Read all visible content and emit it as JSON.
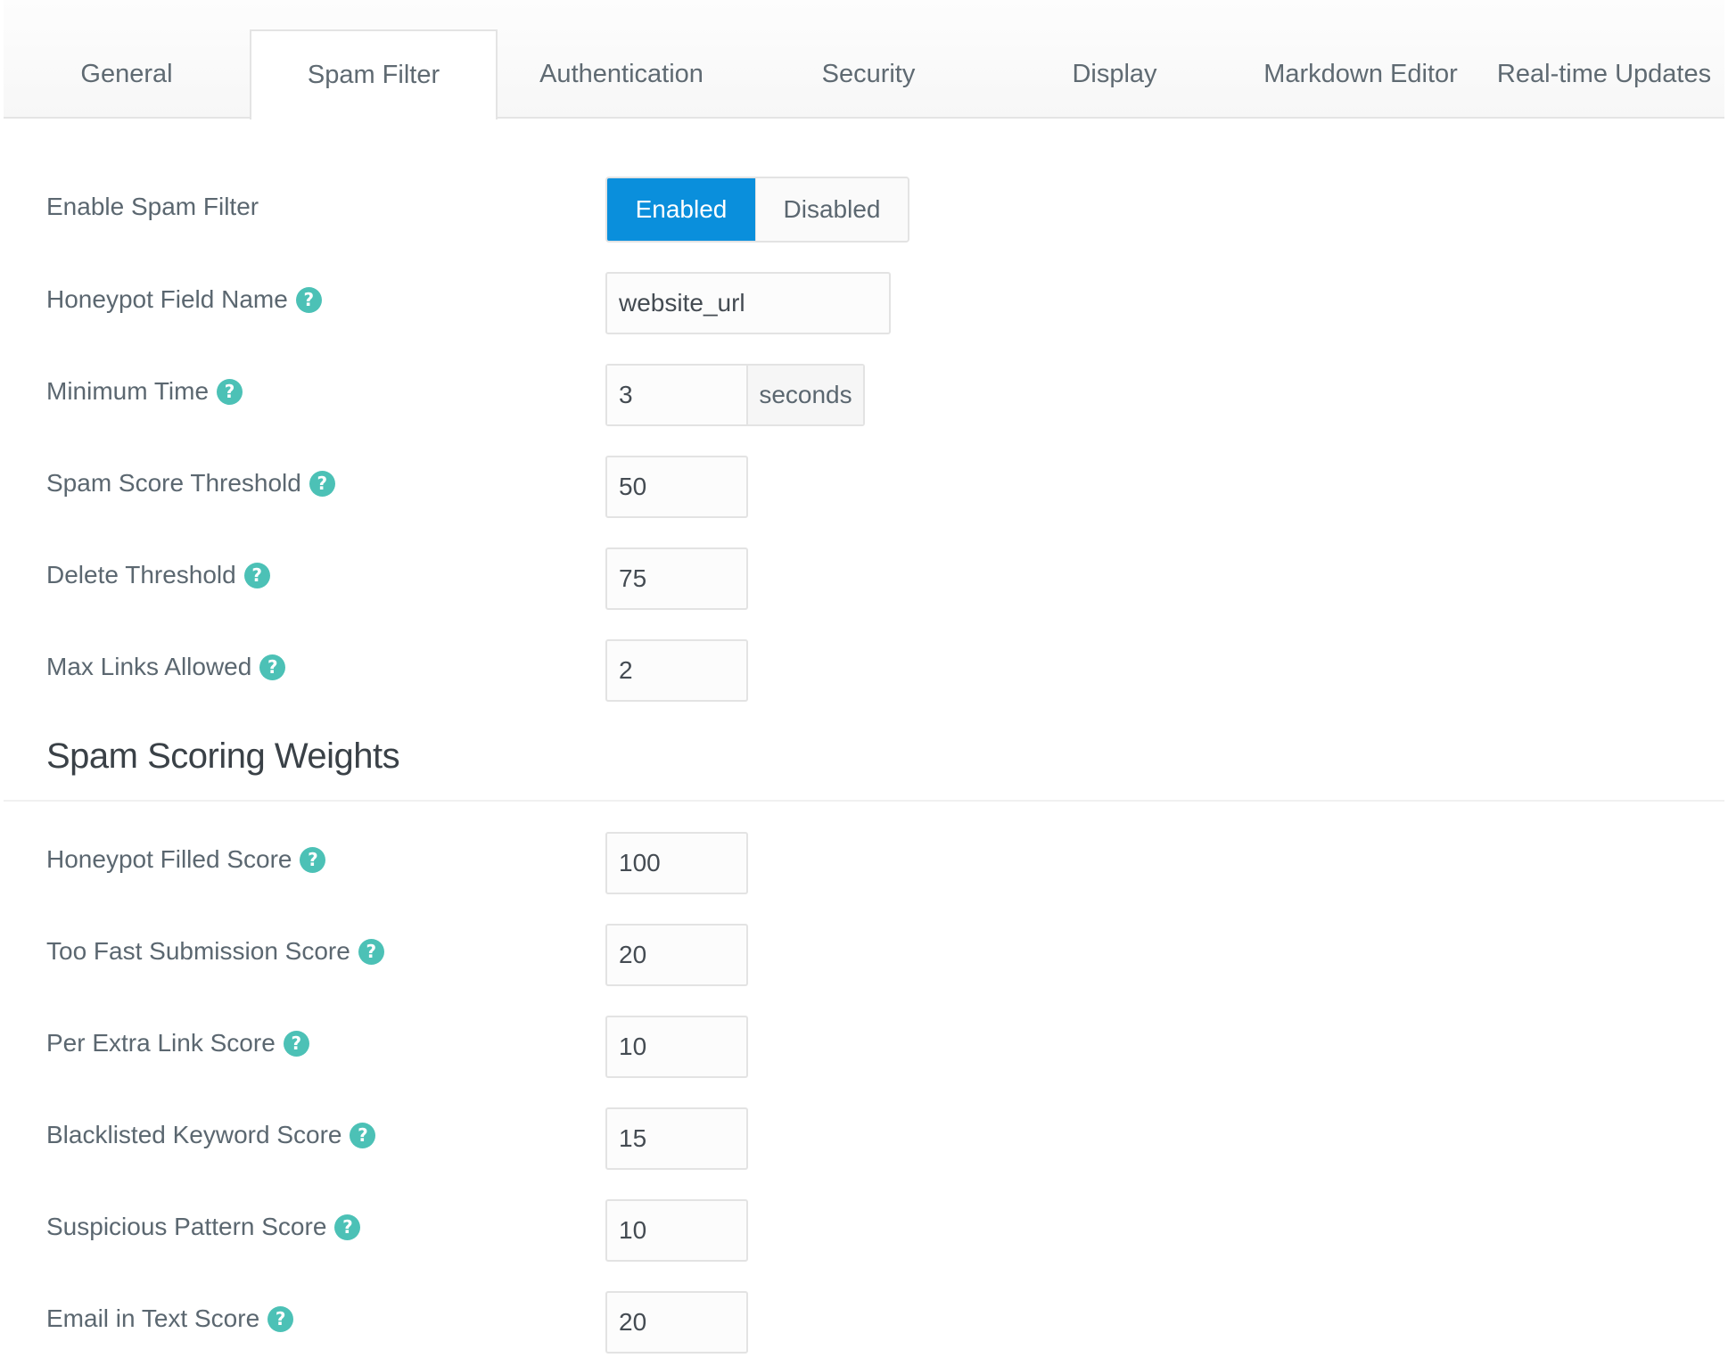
{
  "tabs": [
    {
      "label": "General",
      "active": false
    },
    {
      "label": "Spam Filter",
      "active": true
    },
    {
      "label": "Authentication",
      "active": false
    },
    {
      "label": "Security",
      "active": false
    },
    {
      "label": "Display",
      "active": false
    },
    {
      "label": "Markdown Editor",
      "active": false
    },
    {
      "label": "Real-time Updates",
      "active": false
    }
  ],
  "spam_filter": {
    "enable_label": "Enable Spam Filter",
    "enable_on_label": "Enabled",
    "enable_off_label": "Disabled",
    "enable_selected": "Enabled",
    "honeypot_label": "Honeypot Field Name",
    "honeypot_value": "website_url",
    "min_time_label": "Minimum Time",
    "min_time_value": "3",
    "min_time_unit": "seconds",
    "spam_threshold_label": "Spam Score Threshold",
    "spam_threshold_value": "50",
    "delete_threshold_label": "Delete Threshold",
    "delete_threshold_value": "75",
    "max_links_label": "Max Links Allowed",
    "max_links_value": "2"
  },
  "weights": {
    "section_title": "Spam Scoring Weights",
    "honeypot_filled_label": "Honeypot Filled Score",
    "honeypot_filled_value": "100",
    "too_fast_label": "Too Fast Submission Score",
    "too_fast_value": "20",
    "extra_link_label": "Per Extra Link Score",
    "extra_link_value": "10",
    "blacklisted_label": "Blacklisted Keyword Score",
    "blacklisted_value": "15",
    "suspicious_label": "Suspicious Pattern Score",
    "suspicious_value": "10",
    "email_label": "Email in Text Score",
    "email_value": "20"
  },
  "help_glyph": "?",
  "colors": {
    "accent": "#0a8fdc",
    "help_icon": "#4cc1b6"
  }
}
